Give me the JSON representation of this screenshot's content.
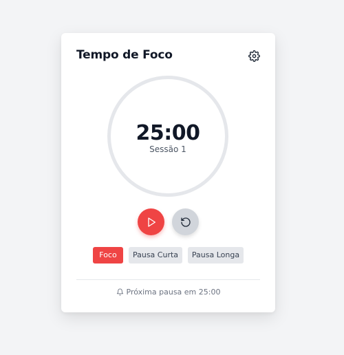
{
  "timer": {
    "title": "Tempo de Foco",
    "time": "25:00",
    "session": "Sessão 1"
  },
  "icons": {
    "settings": "gear-icon",
    "play": "play-icon",
    "reset": "rotate-ccw-icon",
    "bell": "bell-icon"
  },
  "modes": [
    {
      "label": "Foco",
      "active": true
    },
    {
      "label": "Pausa Curta",
      "active": false
    },
    {
      "label": "Pausa Longa",
      "active": false
    }
  ],
  "footer": {
    "next_break": "Próxima pausa em 25:00"
  },
  "colors": {
    "accent": "#ef4444",
    "secondary": "#d1d5db",
    "ring": "#e5e7eb",
    "background": "#f3f4f6"
  }
}
